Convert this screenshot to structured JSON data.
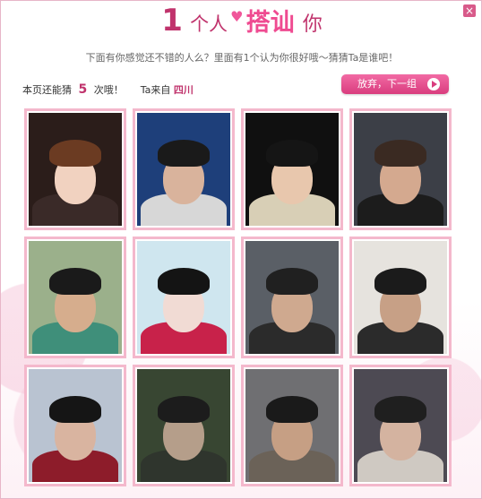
{
  "header": {
    "title_num": "1",
    "title_part1": "个人",
    "title_part2": "搭讪",
    "title_part3": "你",
    "subtitle": "下面有你感觉还不错的人么？里面有1个认为你很好哦～猜猜Ta是谁吧！"
  },
  "info": {
    "prefix": "本页还能猜",
    "count": "5",
    "suffix": "次哦！",
    "from_label": "Ta来自",
    "region": "四川"
  },
  "skip_button": {
    "label": "放弃，下一组"
  },
  "close_label": "×",
  "colors": {
    "accent": "#c0336c",
    "button": "#e2478a",
    "frame": "#f4b8cc"
  },
  "photos": [
    {
      "bg": "#2b1d1a",
      "skin": "#f1d2c0",
      "hair": "#6b3b22",
      "shirt": "#3a2a28"
    },
    {
      "bg": "#1e3f7a",
      "skin": "#d9b39c",
      "hair": "#1a1a1a",
      "shirt": "#d7d7d7"
    },
    {
      "bg": "#101010",
      "skin": "#e8c7ad",
      "hair": "#151515",
      "shirt": "#d8cfb6"
    },
    {
      "bg": "#3c3f47",
      "skin": "#d4a98f",
      "hair": "#3a2a22",
      "shirt": "#1c1c1c"
    },
    {
      "bg": "#9bb08b",
      "skin": "#d6ad8d",
      "hair": "#1a1a1a",
      "shirt": "#3f8f7a"
    },
    {
      "bg": "#cfe6ef",
      "skin": "#f1dbd4",
      "hair": "#141414",
      "shirt": "#c8224a"
    },
    {
      "bg": "#5a5f66",
      "skin": "#cfa98f",
      "hair": "#202020",
      "shirt": "#2b2b2b"
    },
    {
      "bg": "#e6e3de",
      "skin": "#c7a086",
      "hair": "#1b1b1b",
      "shirt": "#2b2b2b"
    },
    {
      "bg": "#b9c3d1",
      "skin": "#d9b4a0",
      "hair": "#151515",
      "shirt": "#8d1c2a"
    },
    {
      "bg": "#384632",
      "skin": "#b59e8a",
      "hair": "#1c1c1c",
      "shirt": "#2f352d"
    },
    {
      "bg": "#6f6f72",
      "skin": "#c69f84",
      "hair": "#1a1a1a",
      "shirt": "#6b6258"
    },
    {
      "bg": "#4d4a53",
      "skin": "#d4b3a0",
      "hair": "#1f1f1f",
      "shirt": "#cfc9c2"
    }
  ]
}
